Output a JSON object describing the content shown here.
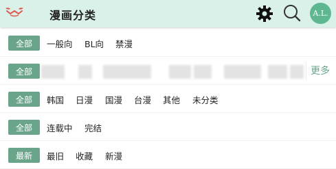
{
  "header": {
    "title": "漫画分类",
    "avatar_text": "A.L.",
    "icons": [
      "logo-icon",
      "gear-icon",
      "search-icon"
    ]
  },
  "filters": {
    "status": {
      "label": "全部",
      "options": [
        "一般向",
        "BL向",
        "禁漫"
      ]
    },
    "tags": {
      "label": "全部",
      "more": "更多"
    },
    "region": {
      "label": "全部",
      "options": [
        "韩国",
        "日漫",
        "国漫",
        "台漫",
        "其他",
        "未分类"
      ]
    },
    "progress": {
      "label": "全部",
      "options": [
        "连载中",
        "完结"
      ]
    },
    "sort": {
      "label": "最新",
      "options": [
        "最旧",
        "收藏",
        "新漫"
      ]
    }
  },
  "colors": {
    "accent": "#6aa58b",
    "header_bg": "#d9f1e8",
    "avatar_bg": "#5fb792"
  }
}
